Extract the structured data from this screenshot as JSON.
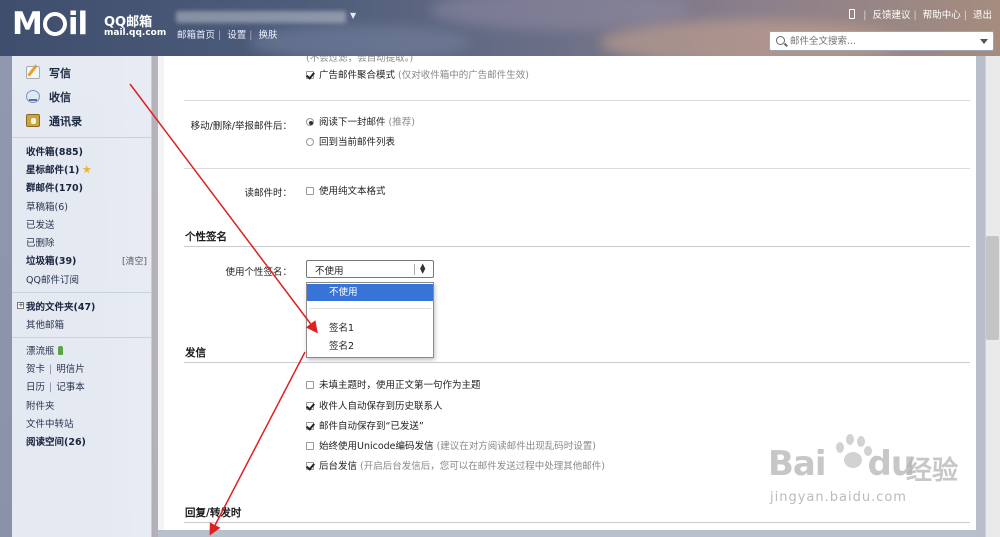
{
  "header": {
    "logo": "M",
    "logo_tail": "il",
    "logo_cn": "QQ邮箱",
    "logo_url": "mail.qq.com",
    "nav": [
      "邮箱首页",
      "设置",
      "换肤"
    ],
    "top_links": [
      "反馈建议",
      "帮助中心",
      "退出"
    ],
    "search_placeholder": "邮件全文搜索..."
  },
  "sidebar": {
    "compose": "写信",
    "inbox": "收信",
    "contacts": "通讯录",
    "folders": [
      {
        "label": "收件箱(885)"
      },
      {
        "label": "星标邮件(1)"
      },
      {
        "label": "群邮件(170)"
      },
      {
        "label": "草稿箱(6)"
      },
      {
        "label": "已发送"
      },
      {
        "label": "已删除"
      },
      {
        "label": "垃圾箱(39)"
      },
      {
        "label": "QQ邮件订阅"
      }
    ],
    "clear_label": "[清空]",
    "my_folders": "我的文件夹(47)",
    "other_mailbox": "其他邮箱",
    "drift_bottle": "漂流瓶",
    "card": "贺卡",
    "postcard": "明信片",
    "calendar": "日历",
    "notes": "记事本",
    "attachments": "附件夹",
    "file_transfer": "文件中转站",
    "reading": "阅读空间(26)"
  },
  "settings": {
    "top_partial": "(不会过滤，会自动提取。)",
    "ad_merge": {
      "label": "广告邮件聚合模式",
      "hint": "(仅对收件箱中的广告邮件生效)",
      "checked": true
    },
    "after_move_label": "移动/删除/举报邮件后：",
    "after_move_options": [
      {
        "label": "阅读下一封邮件",
        "hint": "(推荐)",
        "selected": true
      },
      {
        "label": "回到当前邮件列表",
        "hint": "",
        "selected": false
      }
    ],
    "read_label": "读邮件时：",
    "plain_text": {
      "label": "使用纯文本格式",
      "checked": false
    },
    "signature_section": "个性签名",
    "signature_label": "使用个性签名：",
    "signature_value": "不使用",
    "signature_options": [
      "不使用",
      "签名1",
      "签名2"
    ],
    "send_section": "发信",
    "send_options": [
      {
        "label": "未填主题时，使用正文第一句作为主题",
        "hint": "",
        "checked": false
      },
      {
        "label": "收件人自动保存到历史联系人",
        "hint": "",
        "checked": true
      },
      {
        "label": "邮件自动保存到“已发送”",
        "hint": "",
        "checked": true
      },
      {
        "label": "始终使用Unicode编码发信",
        "hint": "(建议在对方阅读邮件出现乱码时设置)",
        "checked": false
      },
      {
        "label": "后台发信",
        "hint": "(开启后台发信后，您可以在邮件发送过程中处理其他邮件)",
        "checked": true
      }
    ],
    "reply_section": "回复/转发时"
  },
  "watermark": {
    "bai": "Bai",
    "du": "du",
    "jingyan": "经验",
    "url": "jingyan.baidu.com"
  },
  "colors": {
    "selected_option": "#3874d8",
    "arrow": "#e02020"
  }
}
